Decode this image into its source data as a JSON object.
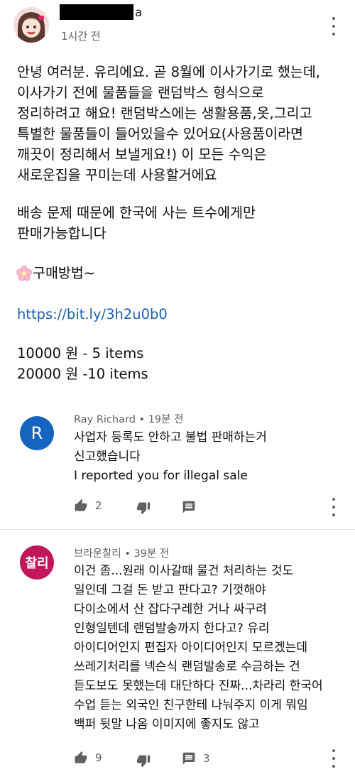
{
  "main_comment": {
    "author_visible_suffix": "a",
    "time": "1시간 전",
    "lines": [
      "안녕 여러분. 유리에요. 곧 8월에 이사가기로 했는데,",
      "이사가기 전에 물품들을 랜덤박스 형식으로",
      "정리하려고 해요! 랜덤박스에는 생활용품,옷,그리고",
      "특별한 물품들이 들어있을수 있어요(사용품이라면",
      "깨끗이 정리해서 보낼게요!) 이 모든 수익은",
      "새로운집을 꾸미는데 사용할거에요"
    ],
    "lines2": [
      "배송 문제 때문에 한국에 사는 트수에게만",
      "판매가능합니다"
    ],
    "how_to_buy": "구매방법~",
    "link": "https://bit.ly/3h2u0b0",
    "prices": [
      "10000 원 - 5 items",
      "20000 원 -10 items"
    ]
  },
  "replies": [
    {
      "avatar_letter": "R",
      "avatar_color": "#1565c0",
      "author": "Ray Richard",
      "time": "19분 전",
      "lines": [
        "사업자 등록도 안하고 불법 판매하는거",
        "신고했습니다",
        "I reported you for illegal sale"
      ],
      "likes": "2",
      "replies": ""
    },
    {
      "avatar_letter": "찰리",
      "avatar_color": "#c2185b",
      "author": "브라운찰리",
      "time": "39분 전",
      "lines": [
        "이건 좀...원래 이사갈때 물건 처리하는 것도",
        "일인데 그걸 돈 받고 판다고? 기껏해야",
        "다이소에서 산 잡다구레한 거나 싸구려",
        "인형일텐데 랜덤발송까지 한다고? 유리",
        "아이디어인지 편집자 아이디어인지 모르겠는데",
        "쓰레기처리를 넥슨식 랜덤발송로 수금하는 건",
        "듣도보도 못했는데 대단하다 진짜...차라리 한국어",
        "수업 듣는 외국인 친구한테 나눠주지 이게 뭐임",
        "백퍼 뒷말 나옴 이미지에 좋지도 않고"
      ],
      "likes": "9",
      "replies": "3"
    }
  ]
}
